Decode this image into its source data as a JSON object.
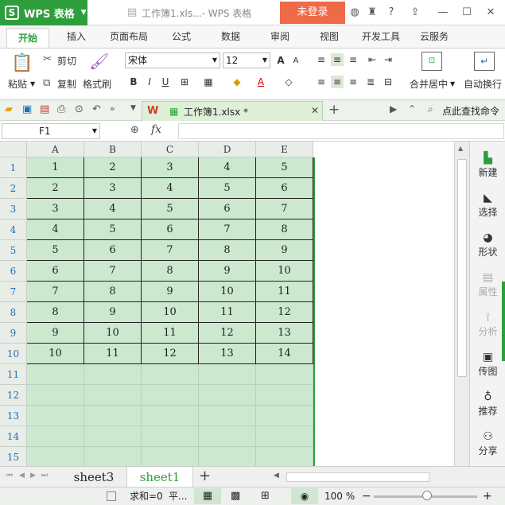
{
  "titlebar": {
    "app_name": "WPS 表格",
    "doc_title": "工作簿1.xls...- WPS 表格",
    "login_label": "未登录"
  },
  "menu": {
    "tabs": [
      "开始",
      "插入",
      "页面布局",
      "公式",
      "数据",
      "审阅",
      "视图",
      "开发工具",
      "云服务"
    ]
  },
  "ribbon": {
    "paste": "粘贴",
    "cut": "剪切",
    "copy": "复制",
    "format_painter": "格式刷",
    "font_name": "宋体",
    "font_size": "12",
    "bold": "B",
    "italic": "I",
    "underline": "U",
    "merge": "合并居中",
    "autowrap": "自动换行"
  },
  "quickbar": {
    "doc_tab": "工作簿1.xlsx *",
    "search": "点此查找命令"
  },
  "formula": {
    "cell_ref": "F1",
    "fx": "fx"
  },
  "grid": {
    "columns": [
      "A",
      "B",
      "C",
      "D",
      "E"
    ],
    "rows": [
      [
        "1",
        "2",
        "3",
        "4",
        "5"
      ],
      [
        "2",
        "3",
        "4",
        "5",
        "6"
      ],
      [
        "3",
        "4",
        "5",
        "6",
        "7"
      ],
      [
        "4",
        "5",
        "6",
        "7",
        "8"
      ],
      [
        "5",
        "6",
        "7",
        "8",
        "9"
      ],
      [
        "6",
        "7",
        "8",
        "9",
        "10"
      ],
      [
        "7",
        "8",
        "9",
        "10",
        "11"
      ],
      [
        "8",
        "9",
        "10",
        "11",
        "12"
      ],
      [
        "9",
        "10",
        "11",
        "12",
        "13"
      ],
      [
        "10",
        "11",
        "12",
        "13",
        "14"
      ]
    ],
    "row_numbers": [
      "1",
      "2",
      "3",
      "4",
      "5",
      "6",
      "7",
      "8",
      "9",
      "10",
      "11",
      "12",
      "13",
      "14",
      "15"
    ]
  },
  "sidepanel": {
    "items": [
      {
        "label": "新建",
        "icon": "new-icon",
        "enabled": true
      },
      {
        "label": "选择",
        "icon": "select-icon",
        "enabled": true
      },
      {
        "label": "形状",
        "icon": "shape-icon",
        "enabled": true
      },
      {
        "label": "属性",
        "icon": "properties-icon",
        "enabled": false
      },
      {
        "label": "分析",
        "icon": "analysis-icon",
        "enabled": false
      },
      {
        "label": "传图",
        "icon": "upload-image-icon",
        "enabled": true
      },
      {
        "label": "推荐",
        "icon": "recommend-icon",
        "enabled": true
      },
      {
        "label": "分享",
        "icon": "share-icon",
        "enabled": true
      }
    ]
  },
  "sheets": {
    "tabs": [
      "sheet3",
      "sheet1"
    ],
    "active": "sheet1",
    "add": "+"
  },
  "status": {
    "sum_text": "求和=0",
    "avg_text": "平...",
    "zoom": "100 %",
    "zoom_minus": "−",
    "zoom_plus": "+"
  },
  "colors": {
    "brand": "#2e9e3c",
    "login": "#ef6a47",
    "selection": "#cce8cf"
  }
}
